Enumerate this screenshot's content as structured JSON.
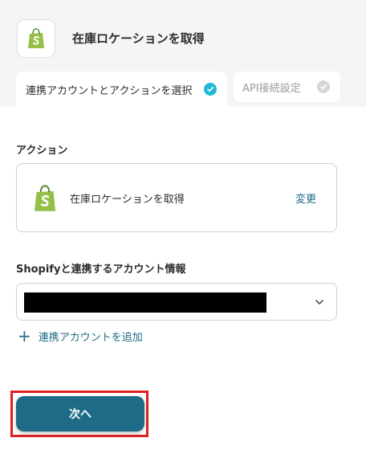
{
  "header": {
    "title": "在庫ロケーションを取得",
    "app_icon": "shopify-icon"
  },
  "tabs": [
    {
      "label": "連携アカウントとアクションを選択",
      "state": "completed",
      "check_color": "#1fbad6"
    },
    {
      "label": "API接続設定",
      "state": "pending",
      "check_color": "#d6d6d6"
    }
  ],
  "action": {
    "section_label": "アクション",
    "name": "在庫ロケーションを取得",
    "change_label": "変更",
    "icon": "shopify-icon"
  },
  "account": {
    "section_label": "Shopifyと連携するアカウント情報",
    "selected_value": "",
    "add_label": "連携アカウントを追加",
    "add_icon": "plus-icon"
  },
  "footer": {
    "next_label": "次へ",
    "next_color": "#1e6b87",
    "highlight_color": "#e0201f"
  }
}
